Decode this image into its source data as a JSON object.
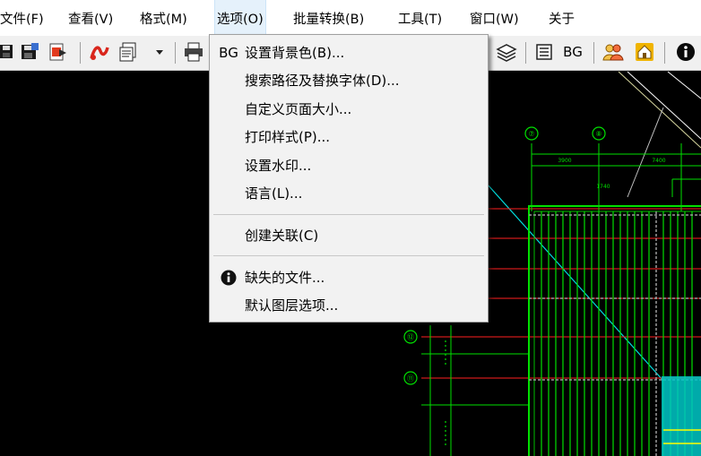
{
  "menubar": {
    "file": "文件(F)",
    "view": "查看(V)",
    "format": "格式(M)",
    "options": "选项(O)",
    "batch": "批量转换(B)",
    "tools": "工具(T)",
    "window": "窗口(W)",
    "about": "关于"
  },
  "toolbar": {
    "bg_label": "BG"
  },
  "options_menu": {
    "bg_icon": "BG",
    "set_background": "设置背景色(B)...",
    "search_path_font": "搜索路径及替换字体(D)...",
    "custom_page_size": "自定义页面大小...",
    "print_style": "打印样式(P)...",
    "watermark": "设置水印...",
    "language": "语言(L)...",
    "create_link": "创建关联(C)",
    "missing_files": "缺失的文件...",
    "default_layer": "默认图层选项..."
  },
  "drawing": {
    "axis_labels": [
      "⑦",
      "⑧",
      "⑫",
      "⑪"
    ],
    "dim_labels": [
      "3900",
      "7400",
      "1740"
    ]
  },
  "colors": {
    "menubar_bg": "#ffffff",
    "menu_bg": "#f2f2f2",
    "canvas_bg": "#000000",
    "cad_green": "#00ff00",
    "cad_red": "#ff0000",
    "cad_cyan": "#00ffff",
    "cad_yellow": "#ffff00"
  }
}
